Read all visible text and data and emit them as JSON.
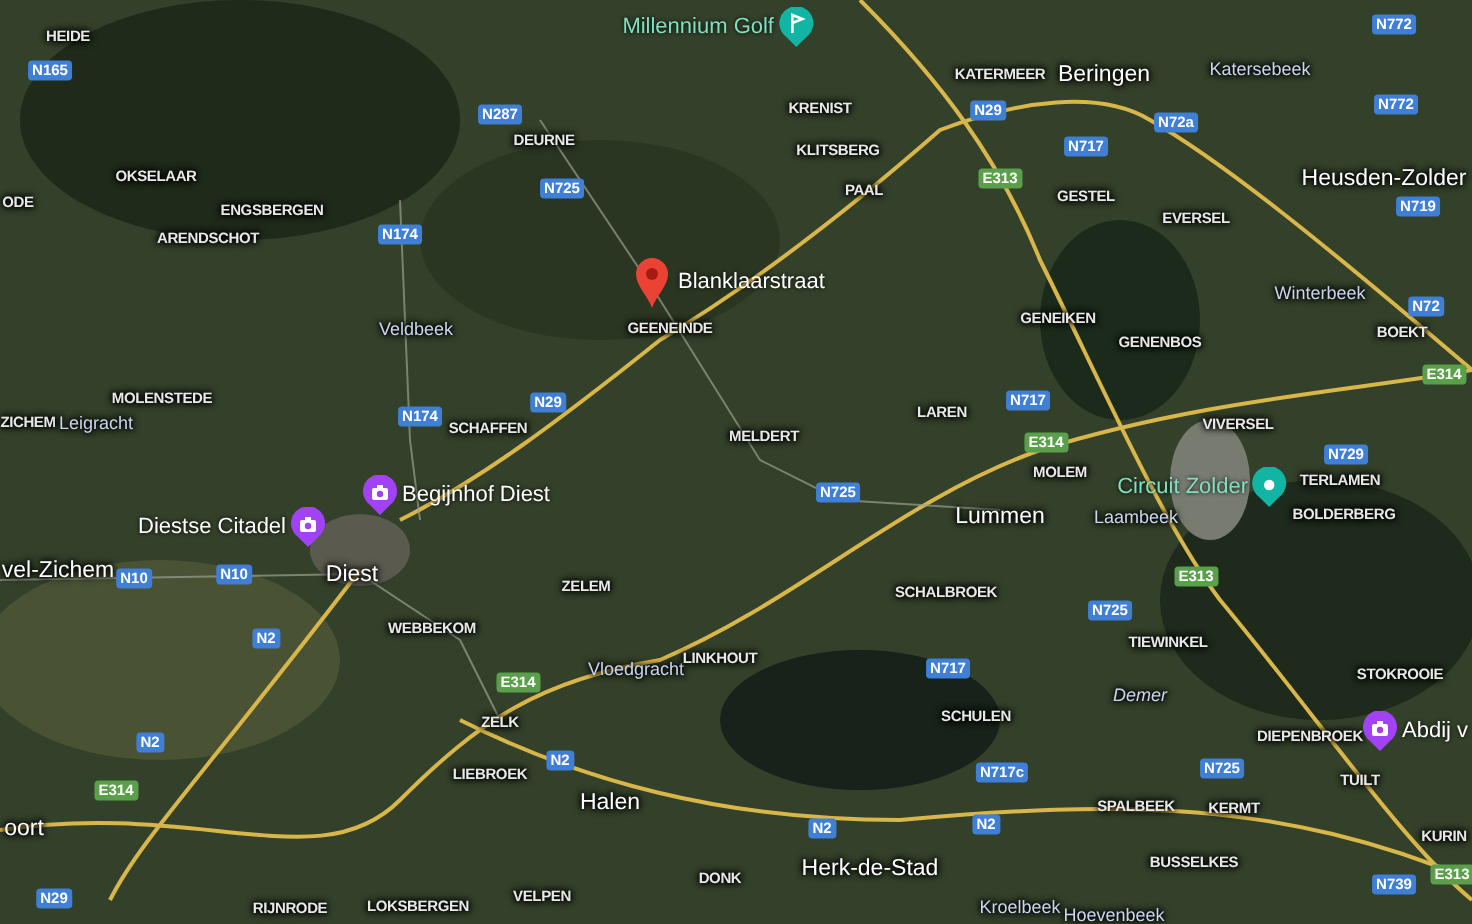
{
  "map": {
    "place_labels": [
      {
        "kind": "village",
        "text": "HEIDE"
      },
      {
        "kind": "village",
        "text": "KATERMEER"
      },
      {
        "kind": "city",
        "text": "Beringen"
      },
      {
        "kind": "locality",
        "text": "Katersebeek"
      },
      {
        "kind": "village",
        "text": "KRENIST"
      },
      {
        "kind": "village",
        "text": "DEURNE"
      },
      {
        "kind": "village",
        "text": "KLITSBERG"
      },
      {
        "kind": "village",
        "text": "OKSELAAR"
      },
      {
        "kind": "city",
        "text": "Heusden-Zolder"
      },
      {
        "kind": "village",
        "text": "PAAL"
      },
      {
        "kind": "village",
        "text": "GESTEL"
      },
      {
        "kind": "village",
        "text": "ODE"
      },
      {
        "kind": "village",
        "text": "ENGSBERGEN"
      },
      {
        "kind": "village",
        "text": "EVERSEL"
      },
      {
        "kind": "village",
        "text": "ARENDSCHOT"
      },
      {
        "kind": "locality",
        "text": "Winterbeek"
      },
      {
        "kind": "village",
        "text": "GENEIKEN"
      },
      {
        "kind": "locality",
        "text": "Veldbeek"
      },
      {
        "kind": "village",
        "text": "GEENEINDE"
      },
      {
        "kind": "village",
        "text": "BOEKT"
      },
      {
        "kind": "village",
        "text": "GENENBOS"
      },
      {
        "kind": "village",
        "text": "MOLENSTEDE"
      },
      {
        "kind": "village",
        "text": "ZICHEM"
      },
      {
        "kind": "locality",
        "text": "Leigracht"
      },
      {
        "kind": "village",
        "text": "SCHAFFEN"
      },
      {
        "kind": "village",
        "text": "MELDERT"
      },
      {
        "kind": "village",
        "text": "LAREN"
      },
      {
        "kind": "village",
        "text": "VIVERSEL"
      },
      {
        "kind": "village",
        "text": "MOLEM"
      },
      {
        "kind": "village",
        "text": "TERLAMEN"
      },
      {
        "kind": "city",
        "text": "Lummen"
      },
      {
        "kind": "locality",
        "text": "Laambeek"
      },
      {
        "kind": "village",
        "text": "BOLDERBERG"
      },
      {
        "kind": "city",
        "text": "vel-Zichem"
      },
      {
        "kind": "city",
        "text": "Diest"
      },
      {
        "kind": "village",
        "text": "ZELEM"
      },
      {
        "kind": "village",
        "text": "SCHALBROEK"
      },
      {
        "kind": "village",
        "text": "WEBBEKOM"
      },
      {
        "kind": "locality",
        "text": "Vloedgracht"
      },
      {
        "kind": "village",
        "text": "LINKHOUT"
      },
      {
        "kind": "village",
        "text": "TIEWINKEL"
      },
      {
        "kind": "village",
        "text": "STOKROOIE"
      },
      {
        "kind": "water",
        "text": "Demer"
      },
      {
        "kind": "village",
        "text": "ZELK"
      },
      {
        "kind": "village",
        "text": "SCHULEN"
      },
      {
        "kind": "village",
        "text": "DIEPENBROEK"
      },
      {
        "kind": "village",
        "text": "LIEBROEK"
      },
      {
        "kind": "village",
        "text": "TUILT"
      },
      {
        "kind": "city",
        "text": "Halen"
      },
      {
        "kind": "village",
        "text": "SPALBEEK"
      },
      {
        "kind": "village",
        "text": "KERMT"
      },
      {
        "kind": "city",
        "text": "oort"
      },
      {
        "kind": "village",
        "text": "KURIN"
      },
      {
        "kind": "village",
        "text": "BUSSELKES"
      },
      {
        "kind": "city",
        "text": "Herk-de-Stad"
      },
      {
        "kind": "village",
        "text": "DONK"
      },
      {
        "kind": "village",
        "text": "VELPEN"
      },
      {
        "kind": "village",
        "text": "RIJNRODE"
      },
      {
        "kind": "village",
        "text": "LOKSBERGEN"
      },
      {
        "kind": "locality",
        "text": "Kroelbeek"
      },
      {
        "kind": "locality",
        "text": "Hoevenbeek"
      }
    ],
    "road_shields": [
      {
        "kind": "national",
        "text": "N165"
      },
      {
        "kind": "national",
        "text": "N287"
      },
      {
        "kind": "national",
        "text": "N725"
      },
      {
        "kind": "national",
        "text": "N174"
      },
      {
        "kind": "national",
        "text": "N174"
      },
      {
        "kind": "national",
        "text": "N29"
      },
      {
        "kind": "national",
        "text": "N29"
      },
      {
        "kind": "national",
        "text": "N717"
      },
      {
        "kind": "national",
        "text": "N72a"
      },
      {
        "kind": "national",
        "text": "N772"
      },
      {
        "kind": "national",
        "text": "N772"
      },
      {
        "kind": "national",
        "text": "N719"
      },
      {
        "kind": "national",
        "text": "N72"
      },
      {
        "kind": "national",
        "text": "N717"
      },
      {
        "kind": "national",
        "text": "N729"
      },
      {
        "kind": "national",
        "text": "N725"
      },
      {
        "kind": "national",
        "text": "N10"
      },
      {
        "kind": "national",
        "text": "N10"
      },
      {
        "kind": "national",
        "text": "N2"
      },
      {
        "kind": "national",
        "text": "N2"
      },
      {
        "kind": "national",
        "text": "N725"
      },
      {
        "kind": "national",
        "text": "N717"
      },
      {
        "kind": "national",
        "text": "N2"
      },
      {
        "kind": "national",
        "text": "N717c"
      },
      {
        "kind": "national",
        "text": "N2"
      },
      {
        "kind": "national",
        "text": "N2"
      },
      {
        "kind": "national",
        "text": "N725"
      },
      {
        "kind": "national",
        "text": "N739"
      },
      {
        "kind": "national",
        "text": "N29"
      },
      {
        "kind": "european",
        "text": "E313"
      },
      {
        "kind": "european",
        "text": "E314"
      },
      {
        "kind": "european",
        "text": "E314"
      },
      {
        "kind": "european",
        "text": "E313"
      },
      {
        "kind": "european",
        "text": "E314"
      },
      {
        "kind": "european",
        "text": "E314"
      },
      {
        "kind": "european",
        "text": "E313"
      }
    ],
    "points_of_interest": [
      {
        "kind": "golf",
        "name": "Millennium Golf",
        "color": "#12b5a3"
      },
      {
        "kind": "racetrack",
        "name": "Circuit Zolder",
        "color": "#12b5a3"
      },
      {
        "kind": "sight",
        "name": "Begijnhof Diest",
        "color": "#a142f4"
      },
      {
        "kind": "sight",
        "name": "Diestse Citadel",
        "color": "#a142f4"
      },
      {
        "kind": "sight",
        "name": "Abdij v",
        "color": "#a142f4"
      }
    ],
    "pin": {
      "label": "Blanklaarstraat"
    }
  }
}
